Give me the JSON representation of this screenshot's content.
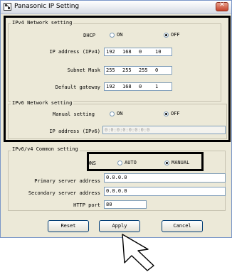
{
  "window": {
    "title": "Panasonic IP Setting"
  },
  "ipv4": {
    "group_title": "IPv4 Network setting",
    "dhcp_label": "DHCP",
    "dhcp_options": {
      "on": "ON",
      "off": "OFF"
    },
    "dhcp_selected": "OFF",
    "ip_label": "IP address (IPv4)",
    "ip": [
      "192",
      "168",
      "0",
      "10"
    ],
    "subnet_label": "Subnet Mask",
    "subnet": [
      "255",
      "255",
      "255",
      "0"
    ],
    "gateway_label": "Default gateway",
    "gateway": [
      "192",
      "168",
      "0",
      "1"
    ]
  },
  "ipv6": {
    "group_title": "IPv6 Network setting",
    "manual_label": "Manual setting",
    "manual_options": {
      "on": "ON",
      "off": "OFF"
    },
    "manual_selected": "OFF",
    "ip_label": "IP address (IPv6)",
    "ip_value": "0:0:0:0:0:0:0:0"
  },
  "common": {
    "group_title": "IPv6/v4 Common setting",
    "dns_label": "DNS",
    "dns_options": {
      "auto": "AUTO",
      "manual": "MANUAL"
    },
    "dns_selected": "MANUAL",
    "primary_label": "Primary server address",
    "primary_value": "0.0.0.0",
    "secondary_label": "Secondary server address",
    "secondary_value": "0.0.0.0",
    "http_label": "HTTP port",
    "http_value": "80"
  },
  "buttons": {
    "reset": "Reset",
    "apply": "Apply",
    "cancel": "Cancel"
  },
  "icons": {
    "app": "network-settings-icon",
    "close": "close-icon",
    "pointer": "arrow-cursor-icon"
  }
}
